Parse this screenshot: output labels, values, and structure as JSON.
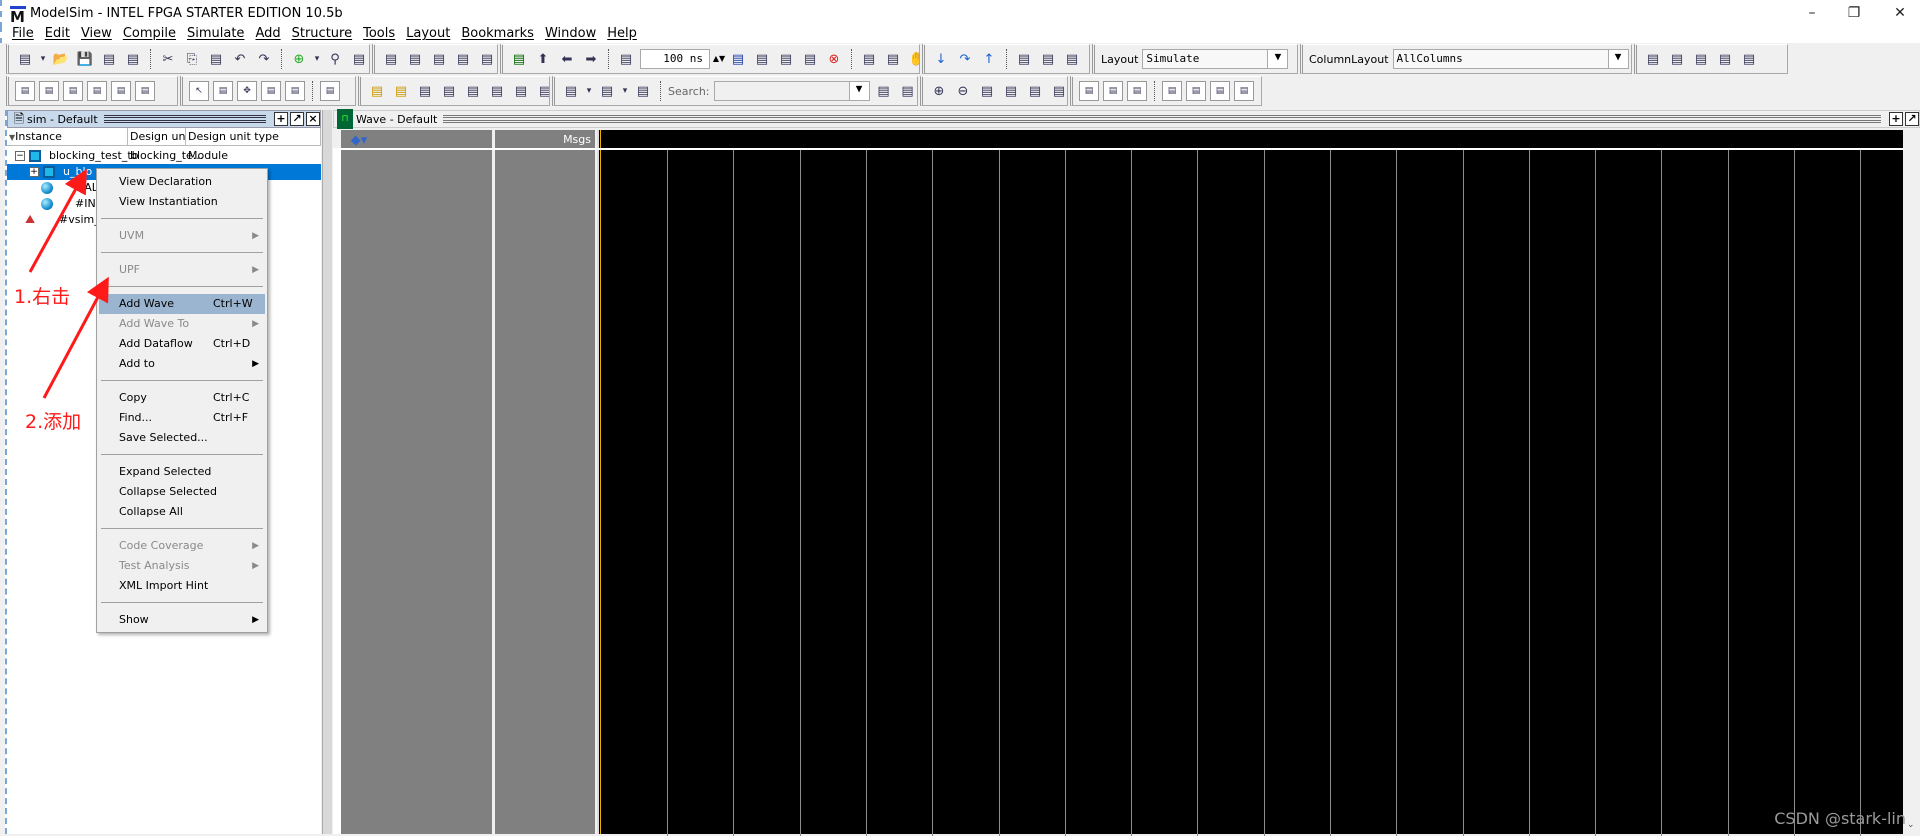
{
  "window": {
    "title": "ModelSim - INTEL FPGA STARTER EDITION 10.5b",
    "logo": "M",
    "controls": [
      "–",
      "❐",
      "✕"
    ]
  },
  "menu": [
    "File",
    "Edit",
    "View",
    "Compile",
    "Simulate",
    "Add",
    "Structure",
    "Tools",
    "Layout",
    "Bookmarks",
    "Window",
    "Help"
  ],
  "toolbar": {
    "row1": [
      [
        "new-icon",
        "dropdown",
        "open-icon",
        "save-icon",
        "reload-icon",
        "print-icon",
        "|",
        "cut-icon",
        "copy-icon",
        "paste-icon",
        "undo-icon",
        "redo-icon",
        "|",
        "add-icon",
        "dropdown",
        "find-icon",
        "structure-icon",
        "modelsim-icon"
      ],
      [
        "compile-icon",
        "compile-help-icon",
        "compile-all-icon",
        "simulate-icon",
        "break-icon"
      ],
      [
        "link-icon",
        "up-icon",
        "back-icon",
        "forward-icon",
        "|",
        "run-length-icon"
      ],
      [
        "run-icon",
        "continue-icon",
        "run-all-icon",
        "break-run-icon",
        "stop-icon",
        "|",
        "restart-icon",
        "performance-icon",
        "hand-icon"
      ],
      [
        "step-icon",
        "step-over-icon",
        "step-out-icon",
        "|",
        "step-dropdown-icon",
        "step-over2-icon",
        "step-out2-icon"
      ]
    ],
    "run_length": "100 ns",
    "layout_label": "Layout",
    "layout_value": "Simulate",
    "columnlayout_label": "ColumnLayout",
    "columnlayout_value": "AllColumns",
    "row1_tail": [
      "wave-add-icon",
      "wave-edit-icon",
      "wave-marker-icon",
      "wave-list-icon",
      "wave-export-icon"
    ],
    "row2": [
      [
        "signal-in-icon",
        "signal-out-icon",
        "signal-inout-icon",
        "signal-internal-icon",
        "signal-all-icon",
        "signal-filter-icon"
      ],
      [
        "select-icon",
        "zoom-mode-icon",
        "pan-icon",
        "edit-mode-icon",
        "insert-cursor-icon",
        "|",
        "dataflow-icon"
      ],
      [
        "cursor-add-icon",
        "cursor-delete-icon",
        "edge-prev-icon",
        "edge-next-icon",
        "edge-fall-prev-icon",
        "edge-fall-next-icon",
        "edge-rise-prev-icon",
        "edge-rise-next-icon"
      ],
      [
        "expand-icon",
        "dropdown",
        "collapse-icon",
        "dropdown",
        "expand-time-icon",
        "|"
      ]
    ],
    "search_label": "Search:",
    "search_value": "",
    "row2_tail": [
      [
        "search-prev-icon",
        "search-next-icon"
      ],
      [
        "zoom-in-icon",
        "zoom-out-icon",
        "zoom-full-icon",
        "zoom-cursor-icon",
        "zoom-range-icon",
        "zoom-last-icon"
      ],
      [
        "wave-style1-icon",
        "wave-style2-icon",
        "wave-style3-icon",
        "|",
        "wave-style4-icon",
        "wave-style5-icon",
        "wave-style6-icon",
        "wave-style7-icon"
      ]
    ]
  },
  "sim_panel": {
    "title": "sim - Default",
    "columns": [
      "Instance",
      "Design unit",
      "Design unit type"
    ],
    "rows": [
      {
        "instance": "blocking_test_tb",
        "unit": "blocking_te...",
        "type": "Module",
        "expander": "−",
        "icon": "module-icon"
      },
      {
        "instance": "u_blo",
        "unit": "",
        "type": "",
        "expander": "+",
        "icon": "module-icon",
        "selected": true
      },
      {
        "instance": "#ALW",
        "unit": "",
        "type": "",
        "icon": "process-icon"
      },
      {
        "instance": "#INIT",
        "unit": "",
        "type": "",
        "icon": "process-icon"
      },
      {
        "instance": "#vsim_ca",
        "unit": "",
        "type": "",
        "icon": "capacity-icon"
      }
    ]
  },
  "wave_panel": {
    "title": "Wave - Default",
    "msgs_label": "Msgs",
    "cursor_color": "#e8b000"
  },
  "context_menu": [
    {
      "label": "View Declaration"
    },
    {
      "label": "View Instantiation"
    },
    {
      "sep": true
    },
    {
      "label": "UVM",
      "disabled": true,
      "submenu": true
    },
    {
      "sep": true
    },
    {
      "label": "UPF",
      "disabled": true,
      "submenu": true
    },
    {
      "sep": true
    },
    {
      "label": "Add Wave",
      "shortcut": "Ctrl+W",
      "highlighted": true
    },
    {
      "label": "Add Wave To",
      "disabled": true,
      "submenu": true
    },
    {
      "label": "Add Dataflow",
      "shortcut": "Ctrl+D"
    },
    {
      "label": "Add to",
      "submenu": true
    },
    {
      "sep": true
    },
    {
      "label": "Copy",
      "shortcut": "Ctrl+C"
    },
    {
      "label": "Find...",
      "shortcut": "Ctrl+F"
    },
    {
      "label": "Save Selected..."
    },
    {
      "sep": true
    },
    {
      "label": "Expand Selected"
    },
    {
      "label": "Collapse Selected"
    },
    {
      "label": "Collapse All"
    },
    {
      "sep": true
    },
    {
      "label": "Code Coverage",
      "disabled": true,
      "submenu": true
    },
    {
      "label": "Test Analysis",
      "disabled": true,
      "submenu": true
    },
    {
      "label": "XML Import Hint"
    },
    {
      "sep": true
    },
    {
      "label": "Show",
      "submenu": true
    }
  ],
  "annotations": {
    "step1": "1.右击",
    "step2": "2.添加",
    "color": "#ff1a1a"
  },
  "watermark": "CSDN @stark-lin"
}
